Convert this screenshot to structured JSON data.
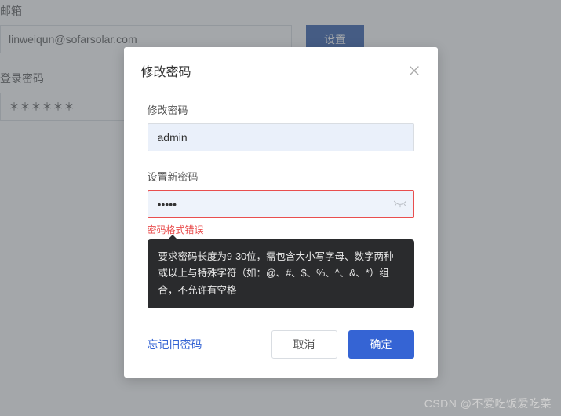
{
  "background": {
    "email_label": "邮箱",
    "email_value": "linweiqun@sofarsolar.com",
    "settings_button": "设置",
    "login_password_label": "登录密码",
    "login_password_value": "＊＊＊＊＊＊"
  },
  "dialog": {
    "title": "修改密码",
    "old_password_label": "修改密码",
    "old_password_value": "admin",
    "new_password_label": "设置新密码",
    "new_password_value": "•••••",
    "error_text": "密码格式错误",
    "tooltip": "要求密码长度为9-30位，需包含大小写字母、数字两种或以上与特殊字符（如：@、#、$、%、^、&、*）组合，不允许有空格",
    "forgot_link": "忘记旧密码",
    "cancel": "取消",
    "ok": "确定"
  },
  "watermark": "CSDN @不爱吃饭爱吃菜"
}
